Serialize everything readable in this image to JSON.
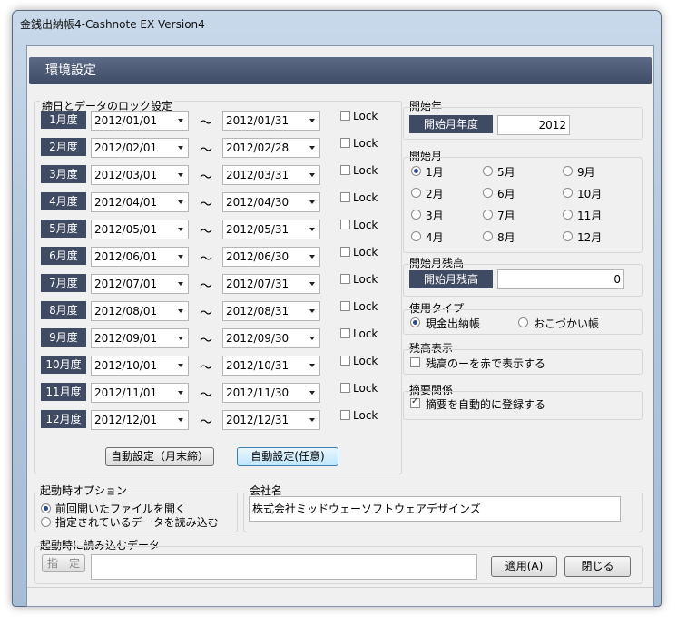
{
  "window": {
    "title": "金銭出納帳4-Cashnote EX Version4"
  },
  "header": {
    "title": "環境設定"
  },
  "lock_section": {
    "label": "締日とデータのロック設定",
    "lock_label": "Lock",
    "tilde": "～",
    "rows": [
      {
        "month": "1月度",
        "start": "2012/01/01",
        "end": "2012/01/31"
      },
      {
        "month": "2月度",
        "start": "2012/02/01",
        "end": "2012/02/28"
      },
      {
        "month": "3月度",
        "start": "2012/03/01",
        "end": "2012/03/31"
      },
      {
        "month": "4月度",
        "start": "2012/04/01",
        "end": "2012/04/30"
      },
      {
        "month": "5月度",
        "start": "2012/05/01",
        "end": "2012/05/31"
      },
      {
        "month": "6月度",
        "start": "2012/06/01",
        "end": "2012/06/30"
      },
      {
        "month": "7月度",
        "start": "2012/07/01",
        "end": "2012/07/31"
      },
      {
        "month": "8月度",
        "start": "2012/08/01",
        "end": "2012/08/31"
      },
      {
        "month": "9月度",
        "start": "2012/09/01",
        "end": "2012/09/30"
      },
      {
        "month": "10月度",
        "start": "2012/10/01",
        "end": "2012/10/31"
      },
      {
        "month": "11月度",
        "start": "2012/11/01",
        "end": "2012/11/30"
      },
      {
        "month": "12月度",
        "start": "2012/12/01",
        "end": "2012/12/31"
      }
    ],
    "auto_month_end_button": "自動設定（月末締）",
    "auto_custom_button": "自動設定(任意)"
  },
  "start_year": {
    "label": "開始年",
    "tag": "開始月年度",
    "value": "2012"
  },
  "start_month": {
    "label": "開始月",
    "options": [
      "1月",
      "5月",
      "9月",
      "2月",
      "6月",
      "10月",
      "3月",
      "7月",
      "11月",
      "4月",
      "8月",
      "12月"
    ],
    "selected": "1月"
  },
  "start_balance": {
    "label": "開始月残高",
    "tag": "開始月残高",
    "value": "0"
  },
  "usage_type": {
    "label": "使用タイプ",
    "options": [
      "現金出納帳",
      "おこづかい帳"
    ],
    "selected": "現金出納帳"
  },
  "balance_display": {
    "label": "残高表示",
    "checkbox_label": "残高のーを赤で表示する",
    "checked": false
  },
  "summary": {
    "label": "摘要関係",
    "checkbox_label": "摘要を自動的に登録する",
    "checked": true
  },
  "startup_option": {
    "label": "起動時オプション",
    "options": [
      "前回開いたファイルを開く",
      "指定されているデータを読み込む"
    ],
    "selected": "前回開いたファイルを開く"
  },
  "company": {
    "label": "会社名",
    "value": "株式会社ミッドウェーソフトウェアデザインズ"
  },
  "startup_data": {
    "label": "起動時に読み込むデータ",
    "specify_button": "指　定",
    "path_value": ""
  },
  "buttons": {
    "apply": "適用(A)",
    "close": "閉じる"
  }
}
